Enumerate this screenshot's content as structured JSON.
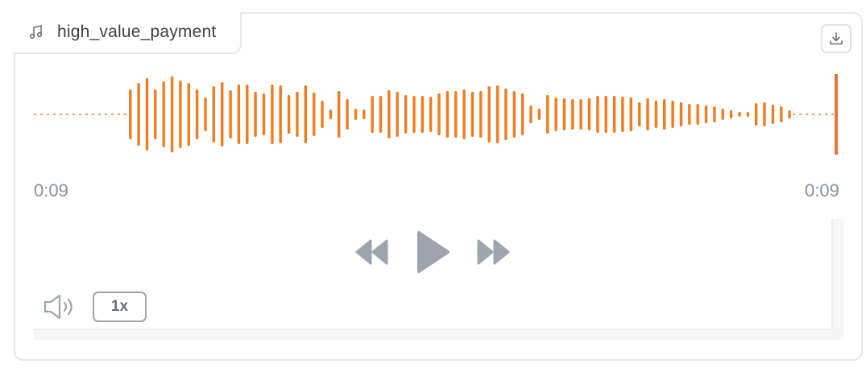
{
  "file": {
    "name": "high_value_payment",
    "icon": "music-note-icon"
  },
  "toolbar": {
    "download_icon": "download-icon"
  },
  "playback": {
    "current_time": "0:09",
    "duration": "0:09",
    "speed_label": "1x",
    "progress": 1.0
  },
  "controls": {
    "rewind_icon": "rewind-icon",
    "play_icon": "play-icon",
    "forward_icon": "fast-forward-icon",
    "volume_icon": "volume-icon"
  },
  "colors": {
    "waveform": "#f07c22",
    "cursor": "#e8733f",
    "controls": "#9ea3ad",
    "time_text": "#8b8f98"
  },
  "waveform": {
    "amplitudes": [
      0.62,
      0.78,
      0.9,
      0.62,
      0.82,
      0.95,
      0.84,
      0.78,
      0.62,
      0.42,
      0.7,
      0.8,
      0.6,
      0.74,
      0.74,
      0.56,
      0.52,
      0.74,
      0.72,
      0.48,
      0.56,
      0.72,
      0.54,
      0.34,
      0.12,
      0.58,
      0.38,
      0.14,
      0.12,
      0.46,
      0.46,
      0.6,
      0.56,
      0.48,
      0.46,
      0.46,
      0.44,
      0.52,
      0.58,
      0.58,
      0.62,
      0.56,
      0.58,
      0.7,
      0.72,
      0.64,
      0.58,
      0.52,
      0.22,
      0.14,
      0.48,
      0.42,
      0.4,
      0.38,
      0.38,
      0.4,
      0.46,
      0.46,
      0.46,
      0.44,
      0.42,
      0.3,
      0.4,
      0.34,
      0.38,
      0.34,
      0.3,
      0.26,
      0.26,
      0.22,
      0.2,
      0.14,
      0.1,
      0.06,
      0.06,
      0.28,
      0.3,
      0.24,
      0.2,
      0.1
    ],
    "silent_fraction_start": 0.12,
    "silent_fraction_end": 0.06
  }
}
